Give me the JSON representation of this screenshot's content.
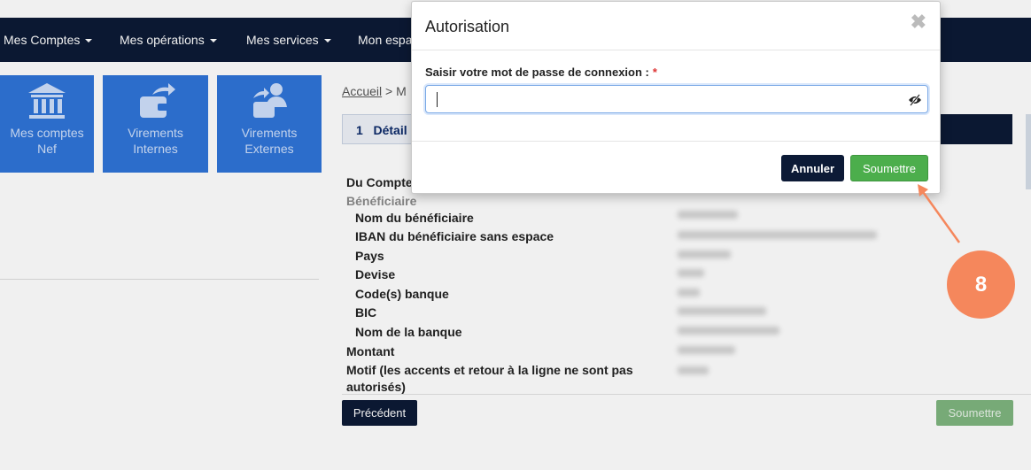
{
  "nav": {
    "items": [
      {
        "label": "Mes Comptes",
        "has_caret": true
      },
      {
        "label": "Mes opérations",
        "has_caret": true
      },
      {
        "label": "Mes services",
        "has_caret": true
      },
      {
        "label": "Mon espa",
        "has_caret": false
      }
    ]
  },
  "tiles": [
    {
      "line1": "Mes comptes",
      "line2": "Nef",
      "icon": "bank-icon"
    },
    {
      "line1": "Virements",
      "line2": "Internes",
      "icon": "wallet-transfer-icon"
    },
    {
      "line1": "Virements",
      "line2": "Externes",
      "icon": "user-transfer-icon"
    }
  ],
  "breadcrumb": {
    "home": "Accueil",
    "separator": ">",
    "current": "M"
  },
  "step": {
    "number": "1",
    "label": "Détail"
  },
  "details": {
    "from_account": "Du Compte",
    "beneficiary_header": "Bénéficiaire",
    "fields": [
      "Nom du bénéficiaire",
      "IBAN du bénéficiaire sans espace",
      "Pays",
      "Devise",
      "Code(s) banque",
      "BIC",
      "Nom de la banque"
    ],
    "amount": "Montant",
    "reason_line1": "Motif (les accents et retour à la ligne ne sont pas",
    "reason_line2": "autorisés)"
  },
  "actions": {
    "previous": "Précédent",
    "submit": "Soumettre"
  },
  "modal": {
    "title": "Autorisation",
    "close_glyph": "✖",
    "field_label": "Saisir votre mot de passe de connexion :",
    "required_mark": "*",
    "password_value": "",
    "cancel_label": "Annuler",
    "submit_label": "Soumettre"
  },
  "annotation": {
    "step_number": "8"
  },
  "colors": {
    "nav_bg": "#0c1a36",
    "tile_bg": "#2f74d8",
    "submit_green": "#4cae4c",
    "badge_orange": "#f5875c"
  }
}
